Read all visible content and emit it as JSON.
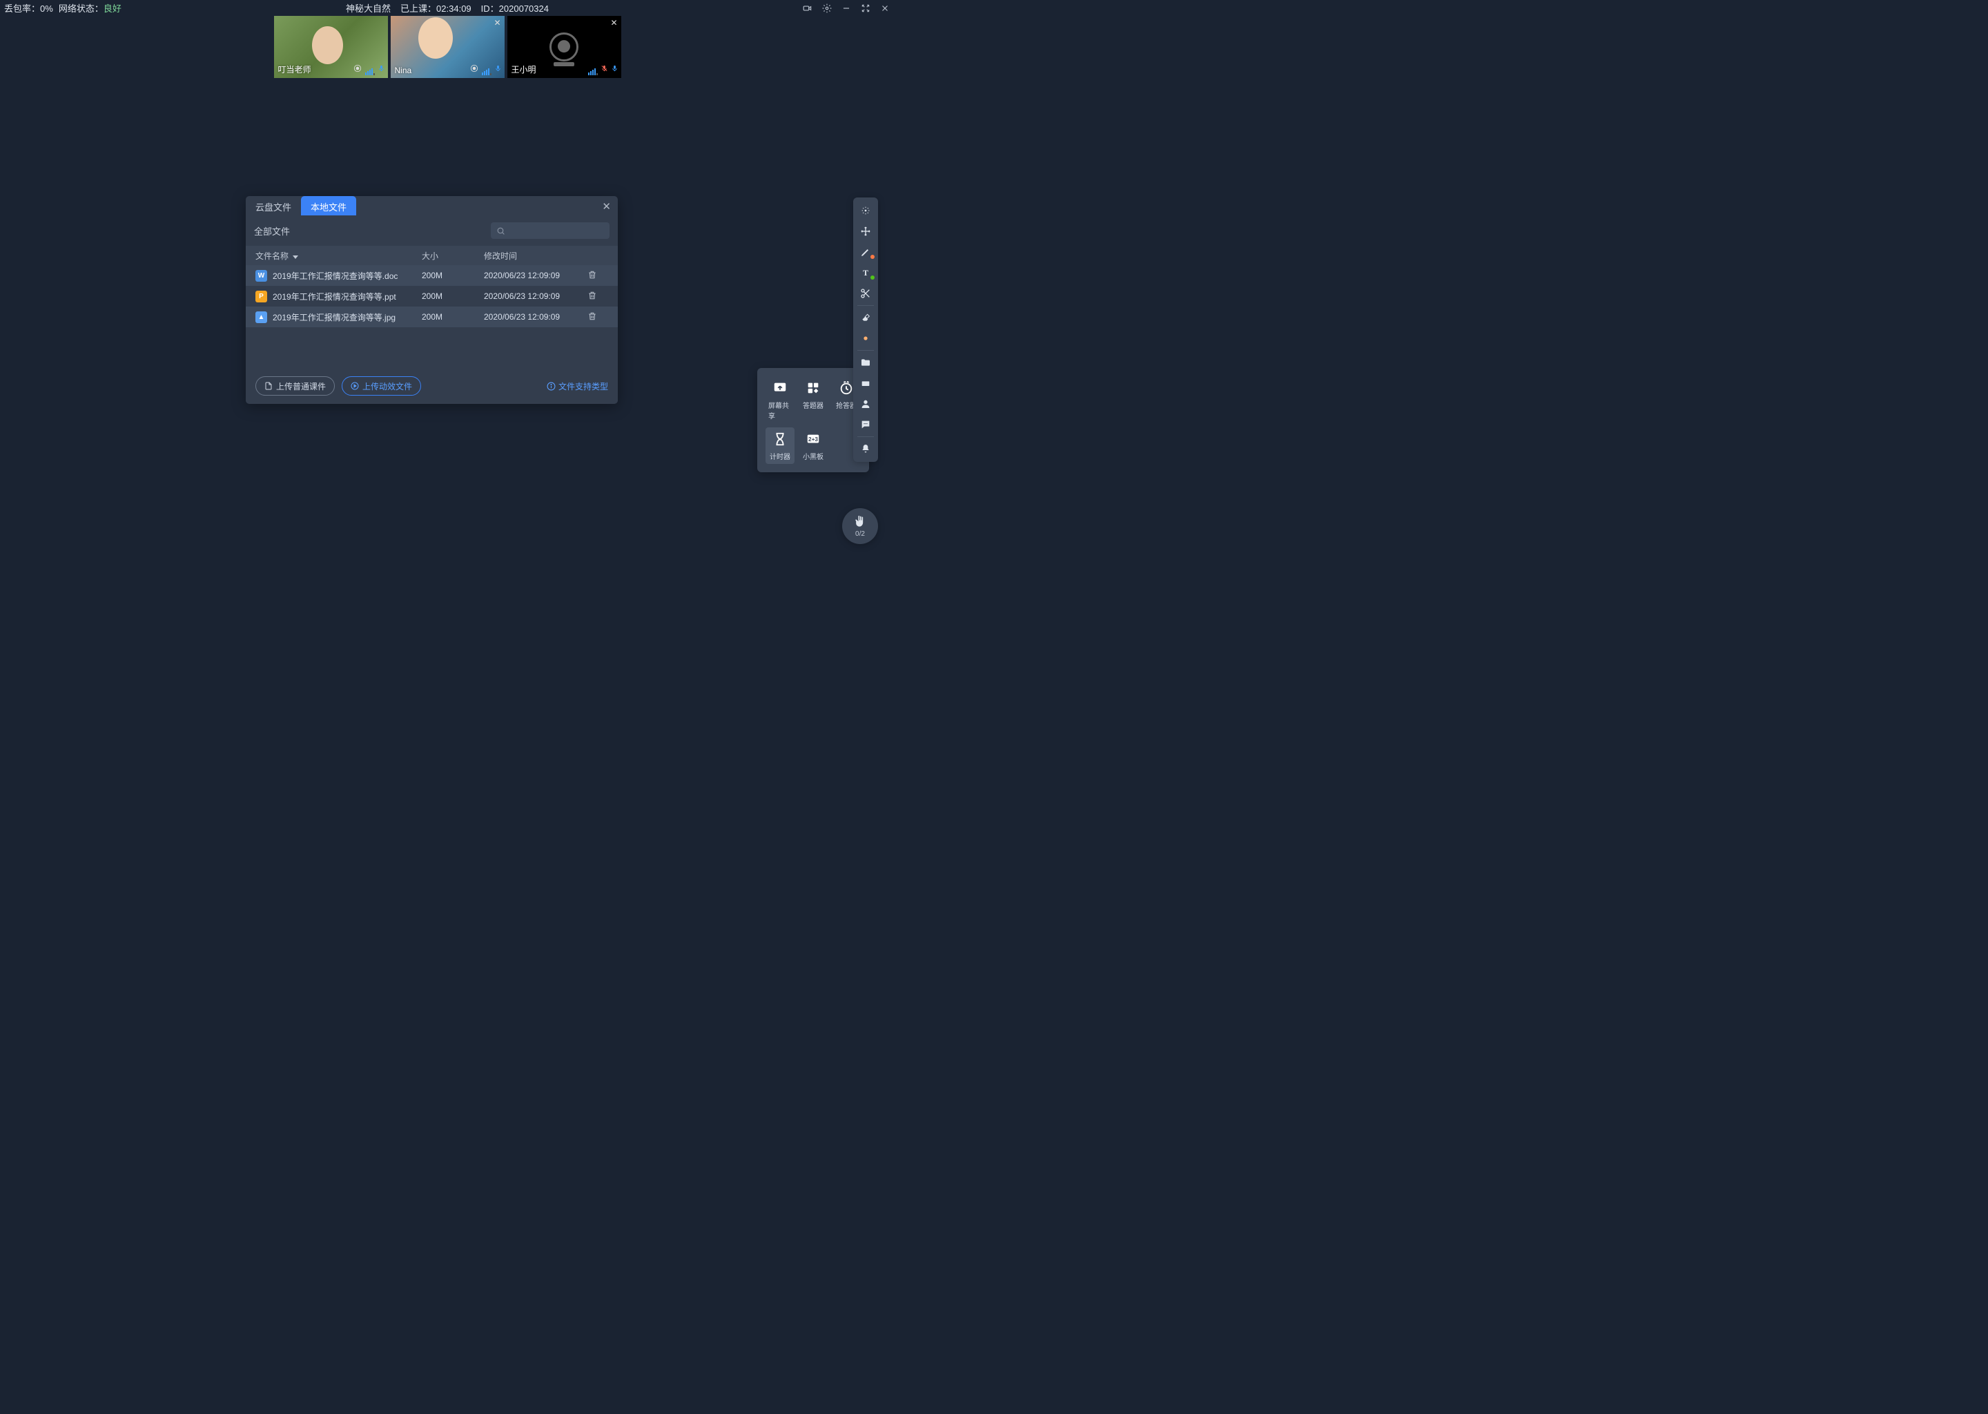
{
  "topbar": {
    "packet_loss_label": "丢包率：",
    "packet_loss_value": "0%",
    "network_label": "网络状态：",
    "network_value": "良好",
    "title": "神秘大自然",
    "elapsed_label": "已上课：",
    "elapsed_value": "02:34:09",
    "id_label": "ID：",
    "id_value": "2020070324"
  },
  "videos": [
    {
      "name": "叮当老师",
      "cam": true,
      "mic": true,
      "closable": false,
      "cls": "person1",
      "rec": true
    },
    {
      "name": "Nina",
      "cam": true,
      "mic": true,
      "closable": true,
      "cls": "person2",
      "rec": true
    },
    {
      "name": "王小明",
      "cam": false,
      "mic": false,
      "closable": true,
      "cls": "",
      "rec": false
    }
  ],
  "modal": {
    "tab_cloud": "云盘文件",
    "tab_local": "本地文件",
    "all_files": "全部文件",
    "col_name": "文件名称",
    "col_size": "大小",
    "col_time": "修改时间",
    "files": [
      {
        "type": "doc",
        "name": "2019年工作汇报情况查询等等.doc",
        "size": "200M",
        "time": "2020/06/23 12:09:09"
      },
      {
        "type": "ppt",
        "name": "2019年工作汇报情况查询等等.ppt",
        "size": "200M",
        "time": "2020/06/23 12:09:09"
      },
      {
        "type": "img",
        "name": "2019年工作汇报情况查询等等.jpg",
        "size": "200M",
        "time": "2020/06/23 12:09:09"
      }
    ],
    "btn_upload_normal": "上传普通课件",
    "btn_upload_anim": "上传动效文件",
    "hint_formats": "文件支持类型"
  },
  "tools": {
    "screen_share": "屏幕共享",
    "answer": "答题器",
    "buzzer": "抢答器",
    "timer": "计时器",
    "blackboard": "小黑板"
  },
  "raise_hand_count": "0/2"
}
